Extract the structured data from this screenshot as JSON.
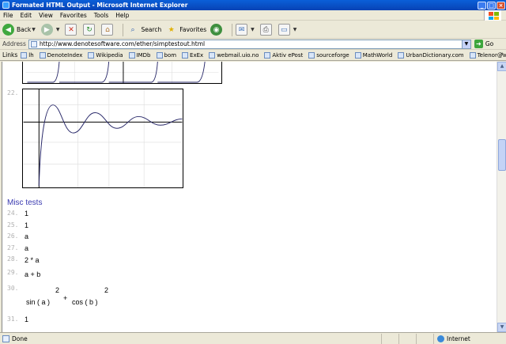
{
  "window": {
    "title": "Formated HTML Output - Microsoft Internet Explorer",
    "min": "_",
    "max": "□",
    "close": "×"
  },
  "menu": [
    "File",
    "Edit",
    "View",
    "Favorites",
    "Tools",
    "Help"
  ],
  "toolbar": {
    "back": "Back",
    "search": "Search",
    "favorites": "Favorites"
  },
  "address": {
    "label": "Address",
    "url": "http://www.denotesoftware.com/ether/simptestout.html",
    "go": "Go"
  },
  "links": {
    "label": "Links",
    "items": [
      "lh",
      "DenoteIndex",
      "Wikipedia",
      "IMDb",
      "bom",
      "ExEx",
      "webmail.uio.no",
      "Aktiv ePost",
      "sourceforge",
      "MathWorld",
      "UrbanDictionary.com",
      "Telenor@work"
    ]
  },
  "content": {
    "plot_line": "22.",
    "section": "Misc tests",
    "rows": [
      {
        "num": "24.",
        "value": "1"
      },
      {
        "num": "25.",
        "value": "1"
      },
      {
        "num": "26.",
        "value": "a"
      },
      {
        "num": "27.",
        "value": "a"
      },
      {
        "num": "28.",
        "value": "2 * a"
      },
      {
        "num": "29.",
        "value": "a + b"
      }
    ],
    "expr": {
      "num": "30.",
      "sin": "sin ( a )",
      "exp1": "2",
      "plus": "+",
      "cos": "cos ( b )",
      "exp2": "2"
    },
    "last": {
      "num": "31.",
      "value": "1"
    }
  },
  "status": {
    "left": "Done",
    "zone": "Internet"
  },
  "colors": {
    "titlebar": "#0a5fd8",
    "section_heading": "#3a3ab0",
    "line_number": "#b0b0b0",
    "plot_curve": "#2a2a6a"
  }
}
